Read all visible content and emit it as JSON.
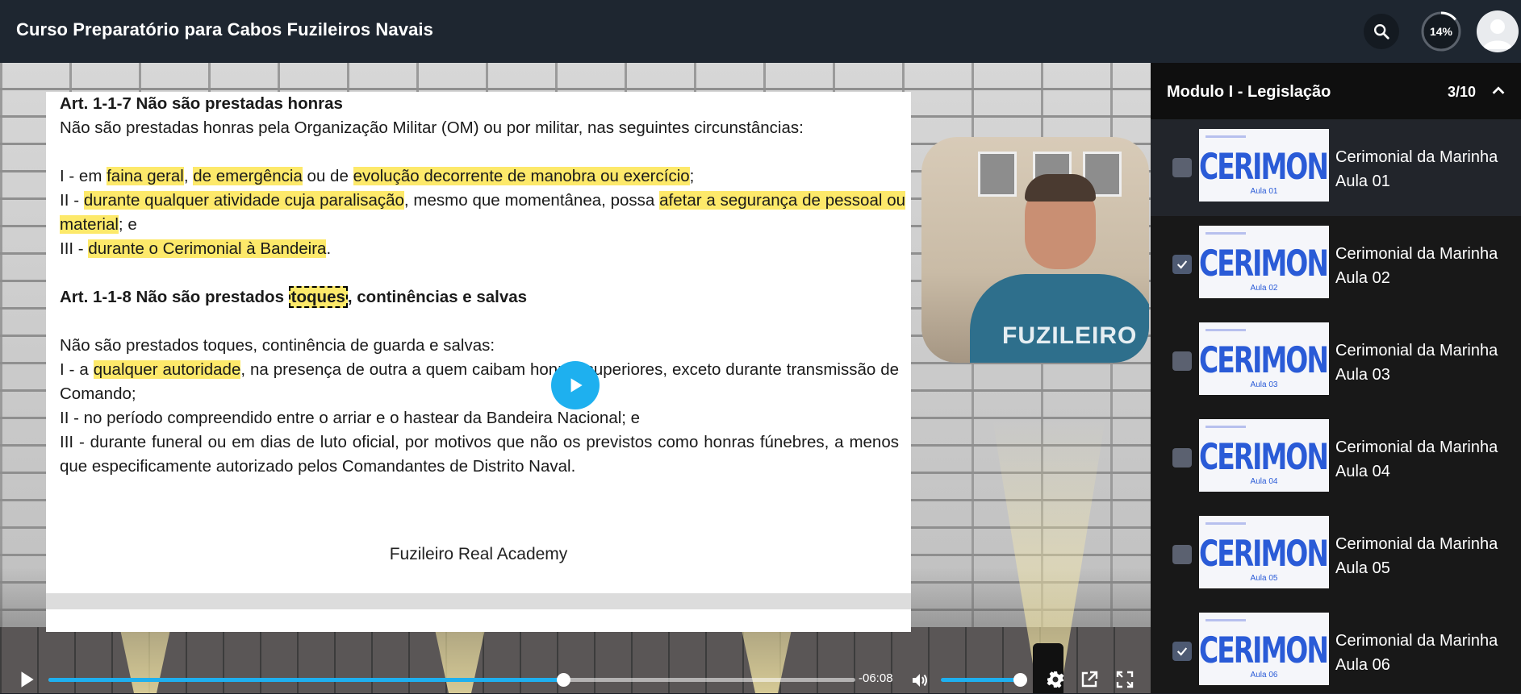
{
  "header": {
    "course_title": "Curso Preparatório para Cabos Fuzileiros Navais",
    "progress_percent_label": "14%",
    "progress_fraction": 0.14
  },
  "slide": {
    "art117_title": "Art. 1-1-7 Não são prestadas honras",
    "art117_intro": "Não são prestadas honras pela Organização Militar (OM) ou por militar, nas seguintes circunstâncias:",
    "i_prefix": "I - em ",
    "i_hl1": "faina geral",
    "i_sep1": ", ",
    "i_hl2": "de emergência",
    "i_mid": " ou de ",
    "i_hl3": "evolução decorrente de manobra ou exercício",
    "i_end": ";",
    "ii_prefix": "II - ",
    "ii_hl1": "durante qualquer atividade cuja paralisação",
    "ii_mid": ", mesmo que momentânea, possa ",
    "ii_hl2": "afetar a segurança de pessoal ou material",
    "ii_end": "; e",
    "iii_prefix": "III - ",
    "iii_hl": "durante o Cerimonial à Bandeira",
    "iii_end": ".",
    "art118_prefix": "Art. 1-1-8 Não são prestados ",
    "art118_boxed": "toques",
    "art118_suffix": ", continências e salvas",
    "art118_intro": "Não são prestados toques, continência de guarda e salvas:",
    "p1_prefix": "I - a ",
    "p1_hl": "qualquer autoridade",
    "p1_rest": ", na presença de outra a quem caibam honras superiores, exceto durante transmissão de Comando;",
    "p2": "II - no período compreendido entre o arriar e o hastear da Bandeira Nacional; e",
    "p3": "III - durante funeral ou em dias de luto oficial, por motivos que não os previstos como honras fúnebres, a menos que especificamente autorizado pelos Comandantes de Distrito Naval.",
    "footer": "Fuzileiro Real Academy"
  },
  "presenter": {
    "shirt_text": "FUZILEIRO"
  },
  "player": {
    "time_remaining": "-06:08",
    "seek_fraction": 0.638,
    "volume_fraction": 0.9
  },
  "sidebar": {
    "module_title": "Modulo I - Legislação",
    "module_count": "3/10",
    "lessons": [
      {
        "title": "Cerimonial da Marinha Aula 01",
        "thumb_word": "CERIMONIAL",
        "thumb_sub": "Aula 01",
        "checked": false,
        "active": true
      },
      {
        "title": "Cerimonial da Marinha Aula 02",
        "thumb_word": "CERIMONIAL",
        "thumb_sub": "Aula 02",
        "checked": true,
        "active": false
      },
      {
        "title": "Cerimonial da Marinha Aula 03",
        "thumb_word": "CERIMONIAL",
        "thumb_sub": "Aula 03",
        "checked": false,
        "active": false
      },
      {
        "title": "Cerimonial da Marinha Aula 04",
        "thumb_word": "CERIMONIAL",
        "thumb_sub": "Aula 04",
        "checked": false,
        "active": false
      },
      {
        "title": "Cerimonial da Marinha Aula 05",
        "thumb_word": "CERIMONIAL",
        "thumb_sub": "Aula 05",
        "checked": false,
        "active": false
      },
      {
        "title": "Cerimonial da Marinha Aula 06",
        "thumb_word": "CERIMONIAL",
        "thumb_sub": "Aula 06",
        "checked": true,
        "active": false
      }
    ]
  },
  "colors": {
    "accent": "#1eb0ef",
    "highlight": "#fde96a",
    "header_bg": "#1e2630",
    "thumb_text": "#2a5bd7"
  },
  "icons": {
    "search": "search-icon",
    "play": "play-icon",
    "volume": "volume-icon",
    "settings": "gear-icon",
    "popout": "external-link-icon",
    "fullscreen": "fullscreen-icon",
    "collapse": "chevron-up-icon",
    "check": "check-icon",
    "avatar": "user-avatar-icon"
  }
}
